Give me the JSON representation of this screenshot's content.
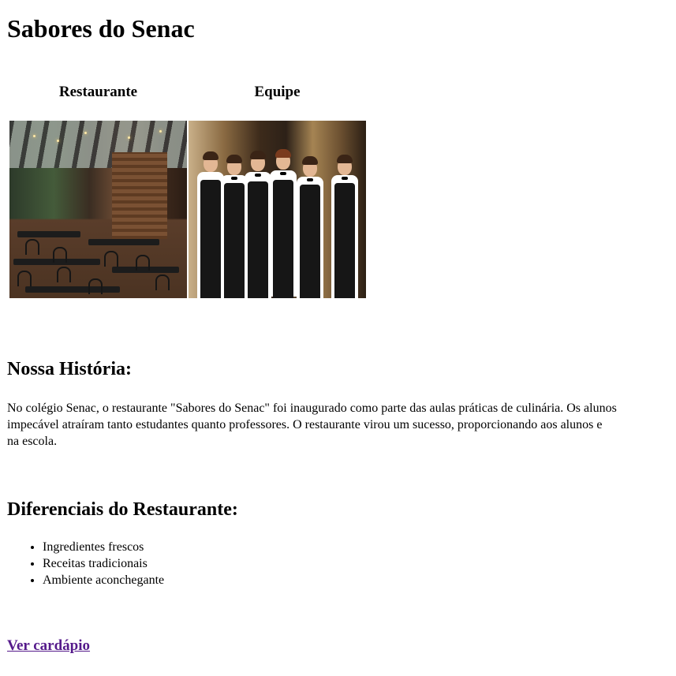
{
  "page": {
    "title": "Sabores do Senac"
  },
  "gallery": {
    "headers": [
      "Restaurante",
      "Equipe"
    ],
    "images": [
      {
        "icon": "restaurant-interior-photo"
      },
      {
        "icon": "staff-team-photo"
      }
    ]
  },
  "history": {
    "title": "Nossa História:",
    "lines": [
      "No colégio Senac, o restaurante \"Sabores do Senac\" foi inaugurado como parte das aulas práticas de culinária. Os alunos",
      "impecável atraíram tanto estudantes quanto professores. O restaurante virou um sucesso, proporcionando aos alunos e",
      "na escola."
    ]
  },
  "differentials": {
    "title": "Diferenciais do Restaurante:",
    "items": [
      "Ingredientes frescos",
      "Receitas tradicionais",
      "Ambiente aconchegante"
    ]
  },
  "link": {
    "label": "Ver cardápio",
    "color": "#551a8b"
  }
}
